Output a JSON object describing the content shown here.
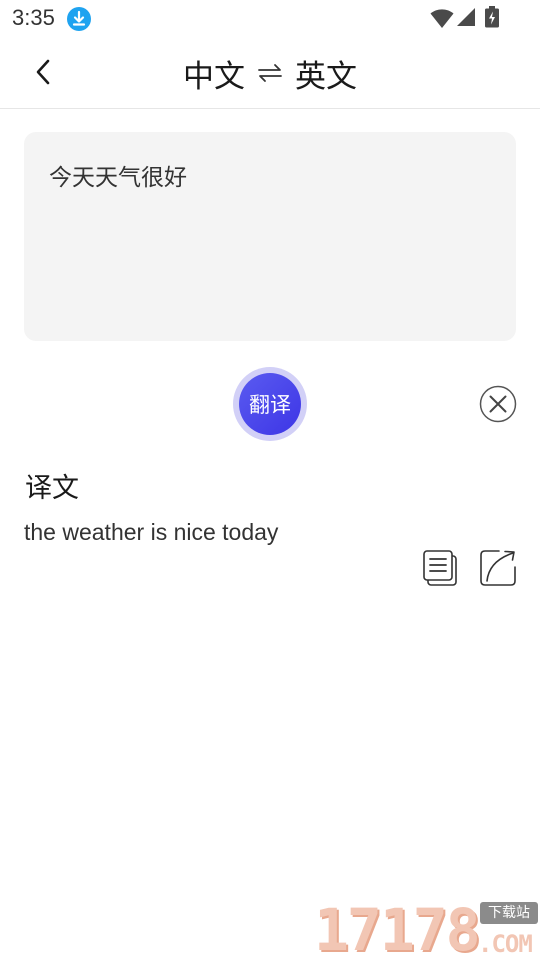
{
  "status_bar": {
    "time": "3:35",
    "icons": [
      "download-icon",
      "wifi-icon",
      "signal-icon",
      "battery-icon"
    ]
  },
  "header": {
    "source_language": "中文",
    "target_language": "英文",
    "back_icon": "chevron-left-icon",
    "swap_icon": "swap-arrows-icon"
  },
  "input": {
    "text": "今天天气很好"
  },
  "actions": {
    "translate_label": "翻译",
    "clear_icon": "close-circle-icon"
  },
  "result": {
    "title": "译文",
    "text": "the weather is nice today",
    "copy_icon": "copy-icon",
    "share_icon": "share-icon"
  },
  "colors": {
    "accent": "#4a46ea",
    "accent_ring": "#d2d0f7",
    "input_background": "#f4f4f4",
    "status_download": "#1fa3f0"
  },
  "watermark": {
    "digits": "17178",
    "tag": "下载站",
    "domain": ".COM"
  }
}
